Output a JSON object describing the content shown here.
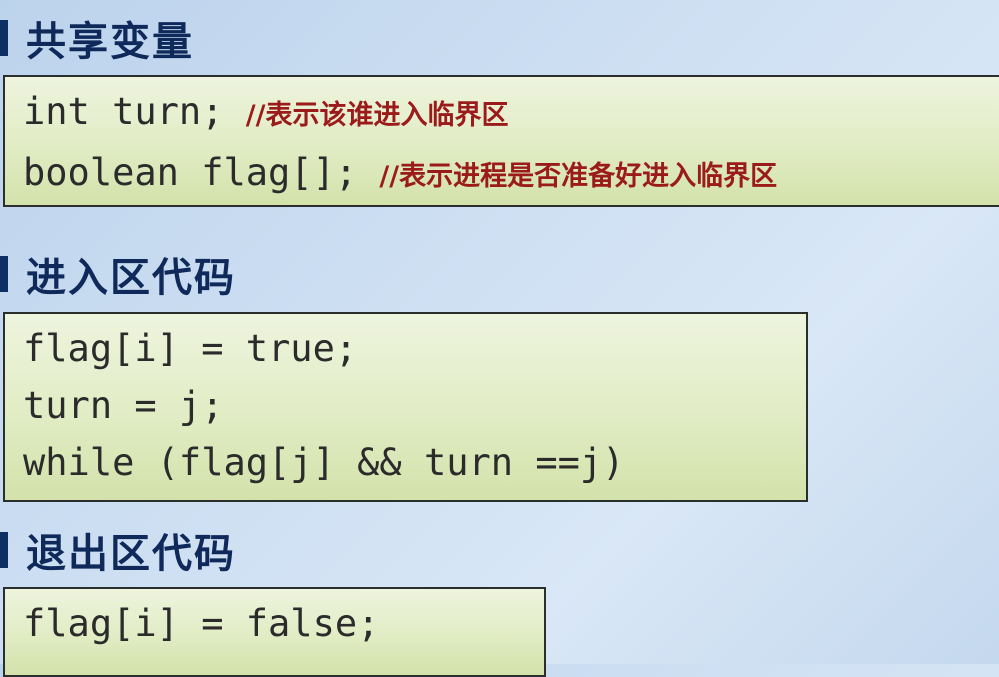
{
  "sections": {
    "shared": {
      "title": "共享变量",
      "lines": [
        {
          "code": "int turn;",
          "comment": "//表示该谁进入临界区"
        },
        {
          "code": "boolean flag[];",
          "comment": "//表示进程是否准备好进入临界区"
        }
      ]
    },
    "entry": {
      "title": "进入区代码",
      "lines": [
        "flag[i] = true;",
        "turn = j;",
        "while (flag[j] && turn ==j)"
      ]
    },
    "exit": {
      "title": "退出区代码",
      "lines": [
        "flag[i] = false;"
      ]
    }
  }
}
